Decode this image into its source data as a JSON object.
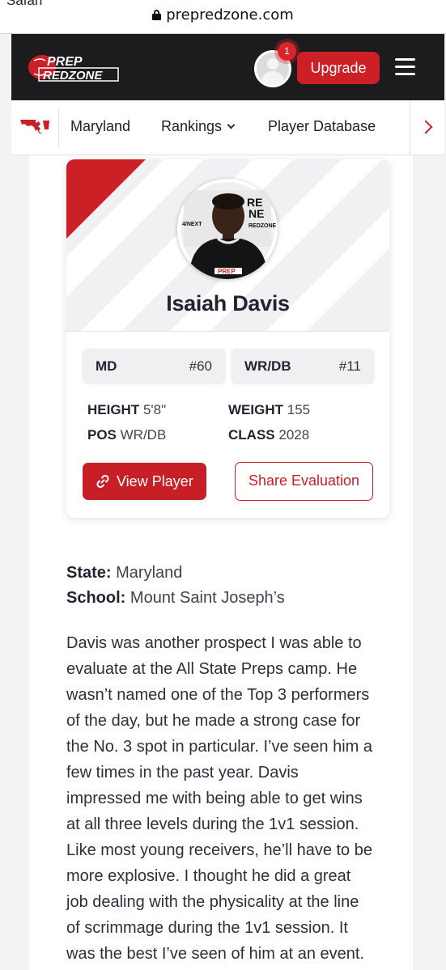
{
  "browser": {
    "back_label": "Safari",
    "url": "prepredzone.com"
  },
  "topnav": {
    "logo_line1": "PREP",
    "logo_line2": "REDZONE",
    "notification_count": "1",
    "upgrade_label": "Upgrade"
  },
  "subnav": {
    "state": "Maryland",
    "rankings": "Rankings",
    "player_database": "Player Database"
  },
  "player": {
    "name": "Isaiah Davis",
    "state_chip_label": "MD",
    "state_rank": "#60",
    "pos_chip_label": "WR/DB",
    "pos_rank": "#11",
    "height_label": "HEIGHT",
    "height": "5'8\"",
    "weight_label": "WEIGHT",
    "weight": "155",
    "pos_label": "POS",
    "pos": "WR/DB",
    "class_label": "CLASS",
    "class": "2028",
    "view_button": "View Player",
    "share_button": "Share Evaluation"
  },
  "article": {
    "state_label": "State:",
    "state_value": "Maryland",
    "school_label": "School:",
    "school_value": "Mount Saint Joseph’s",
    "lines": [
      "Davis was another prospect I was able to",
      "evaluate at the All State Preps camp. He",
      "wasn’t named one of the Top 3 performers",
      "of the day, but he made a strong case for",
      "the No. 3 spot in particular. I’ve seen him a",
      "few times in the past year. Davis",
      "impressed me with being able to get wins",
      "at all three levels during the 1v1 session.",
      "Like most young receivers, he’ll have to be",
      "more explosive. I thought he did a great",
      "job dealing with the physicality at the line",
      "of scrimmage during the 1v1 session. It",
      "was the best I’ve seen of him at an event."
    ]
  },
  "colors": {
    "brand_red": "#cc1f26",
    "nav_dark": "#1c1c1e"
  }
}
